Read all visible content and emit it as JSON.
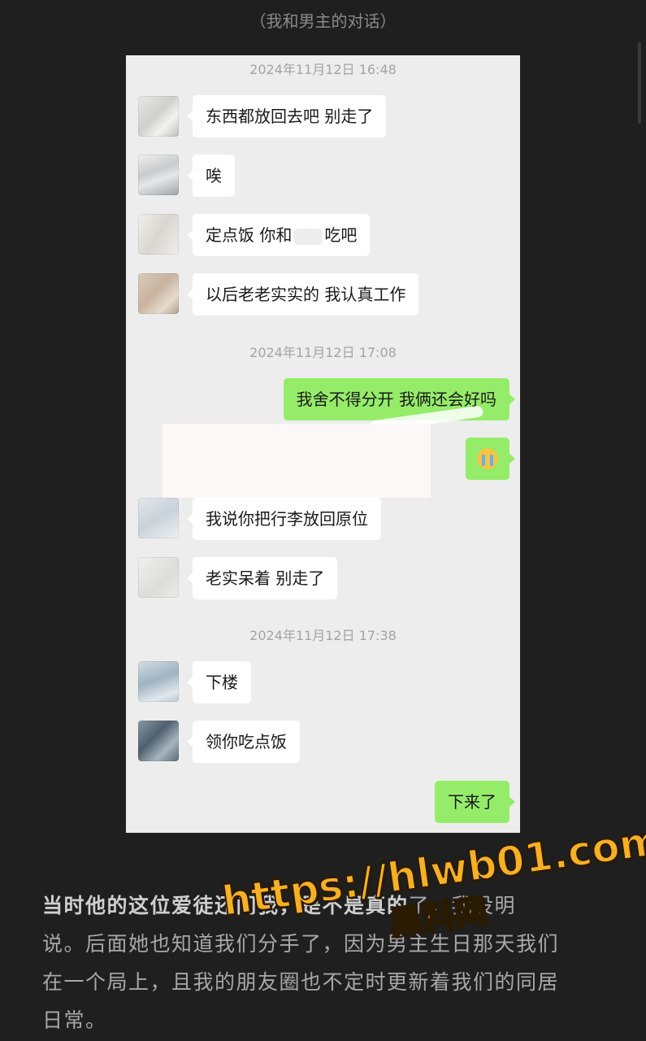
{
  "caption": "（我和男主的对话）",
  "chat": {
    "timestamps": [
      "2024年11月12日 16:48",
      "2024年11月12日 17:08",
      "2024年11月12日 17:38"
    ],
    "messages": [
      {
        "text": "东西都放回去吧 别走了"
      },
      {
        "text": "唉"
      },
      {
        "text_before": "定点饭 你和",
        "text_after": "吃吧"
      },
      {
        "text": "以后老老实实的 我认真工作"
      },
      {
        "text": "我舍不得分开 我俩还会好吗"
      },
      {
        "emoji": "crying-emoji"
      },
      {
        "text": "我说你把行李放回原位"
      },
      {
        "text": "老实呆着 别走了"
      },
      {
        "text": "下楼"
      },
      {
        "text": "领你吃点饭"
      },
      {
        "text": "下来了"
      }
    ],
    "colors": {
      "outgoing": "#95ec69",
      "incoming": "#ffffff",
      "background": "#ededed"
    }
  },
  "article": {
    "bold_lead": "当时他的这位爱徒还问我，是不是真的",
    "line1_rest": "了，我没明",
    "line2": "说。后面她也知道我们分手了，因为男主生日那天我们",
    "line3": "在一个局上，且我的朋友圈也不定时更新着我们的同居",
    "line4": "日常。"
  },
  "watermark": {
    "url": "https://hlwb01.com",
    "brand": "黑料网"
  }
}
